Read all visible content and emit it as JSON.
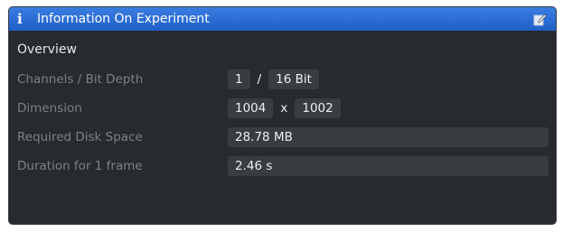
{
  "panel": {
    "title": "Information On Experiment",
    "info_icon": "i",
    "edit_icon_name": "edit-icon",
    "accent_color": "#2a6ad6"
  },
  "overview": {
    "heading": "Overview",
    "channels_label": "Channels / Bit Depth",
    "channels_value": "1",
    "channels_sep": "/",
    "bit_depth_value": "16 Bit",
    "dimension_label": "Dimension",
    "dimension_width": "1004",
    "dimension_sep": "x",
    "dimension_height": "1002",
    "disk_label": "Required Disk Space",
    "disk_value": "28.78 MB",
    "duration_label": "Duration for 1 frame",
    "duration_value": "2.46 s"
  }
}
